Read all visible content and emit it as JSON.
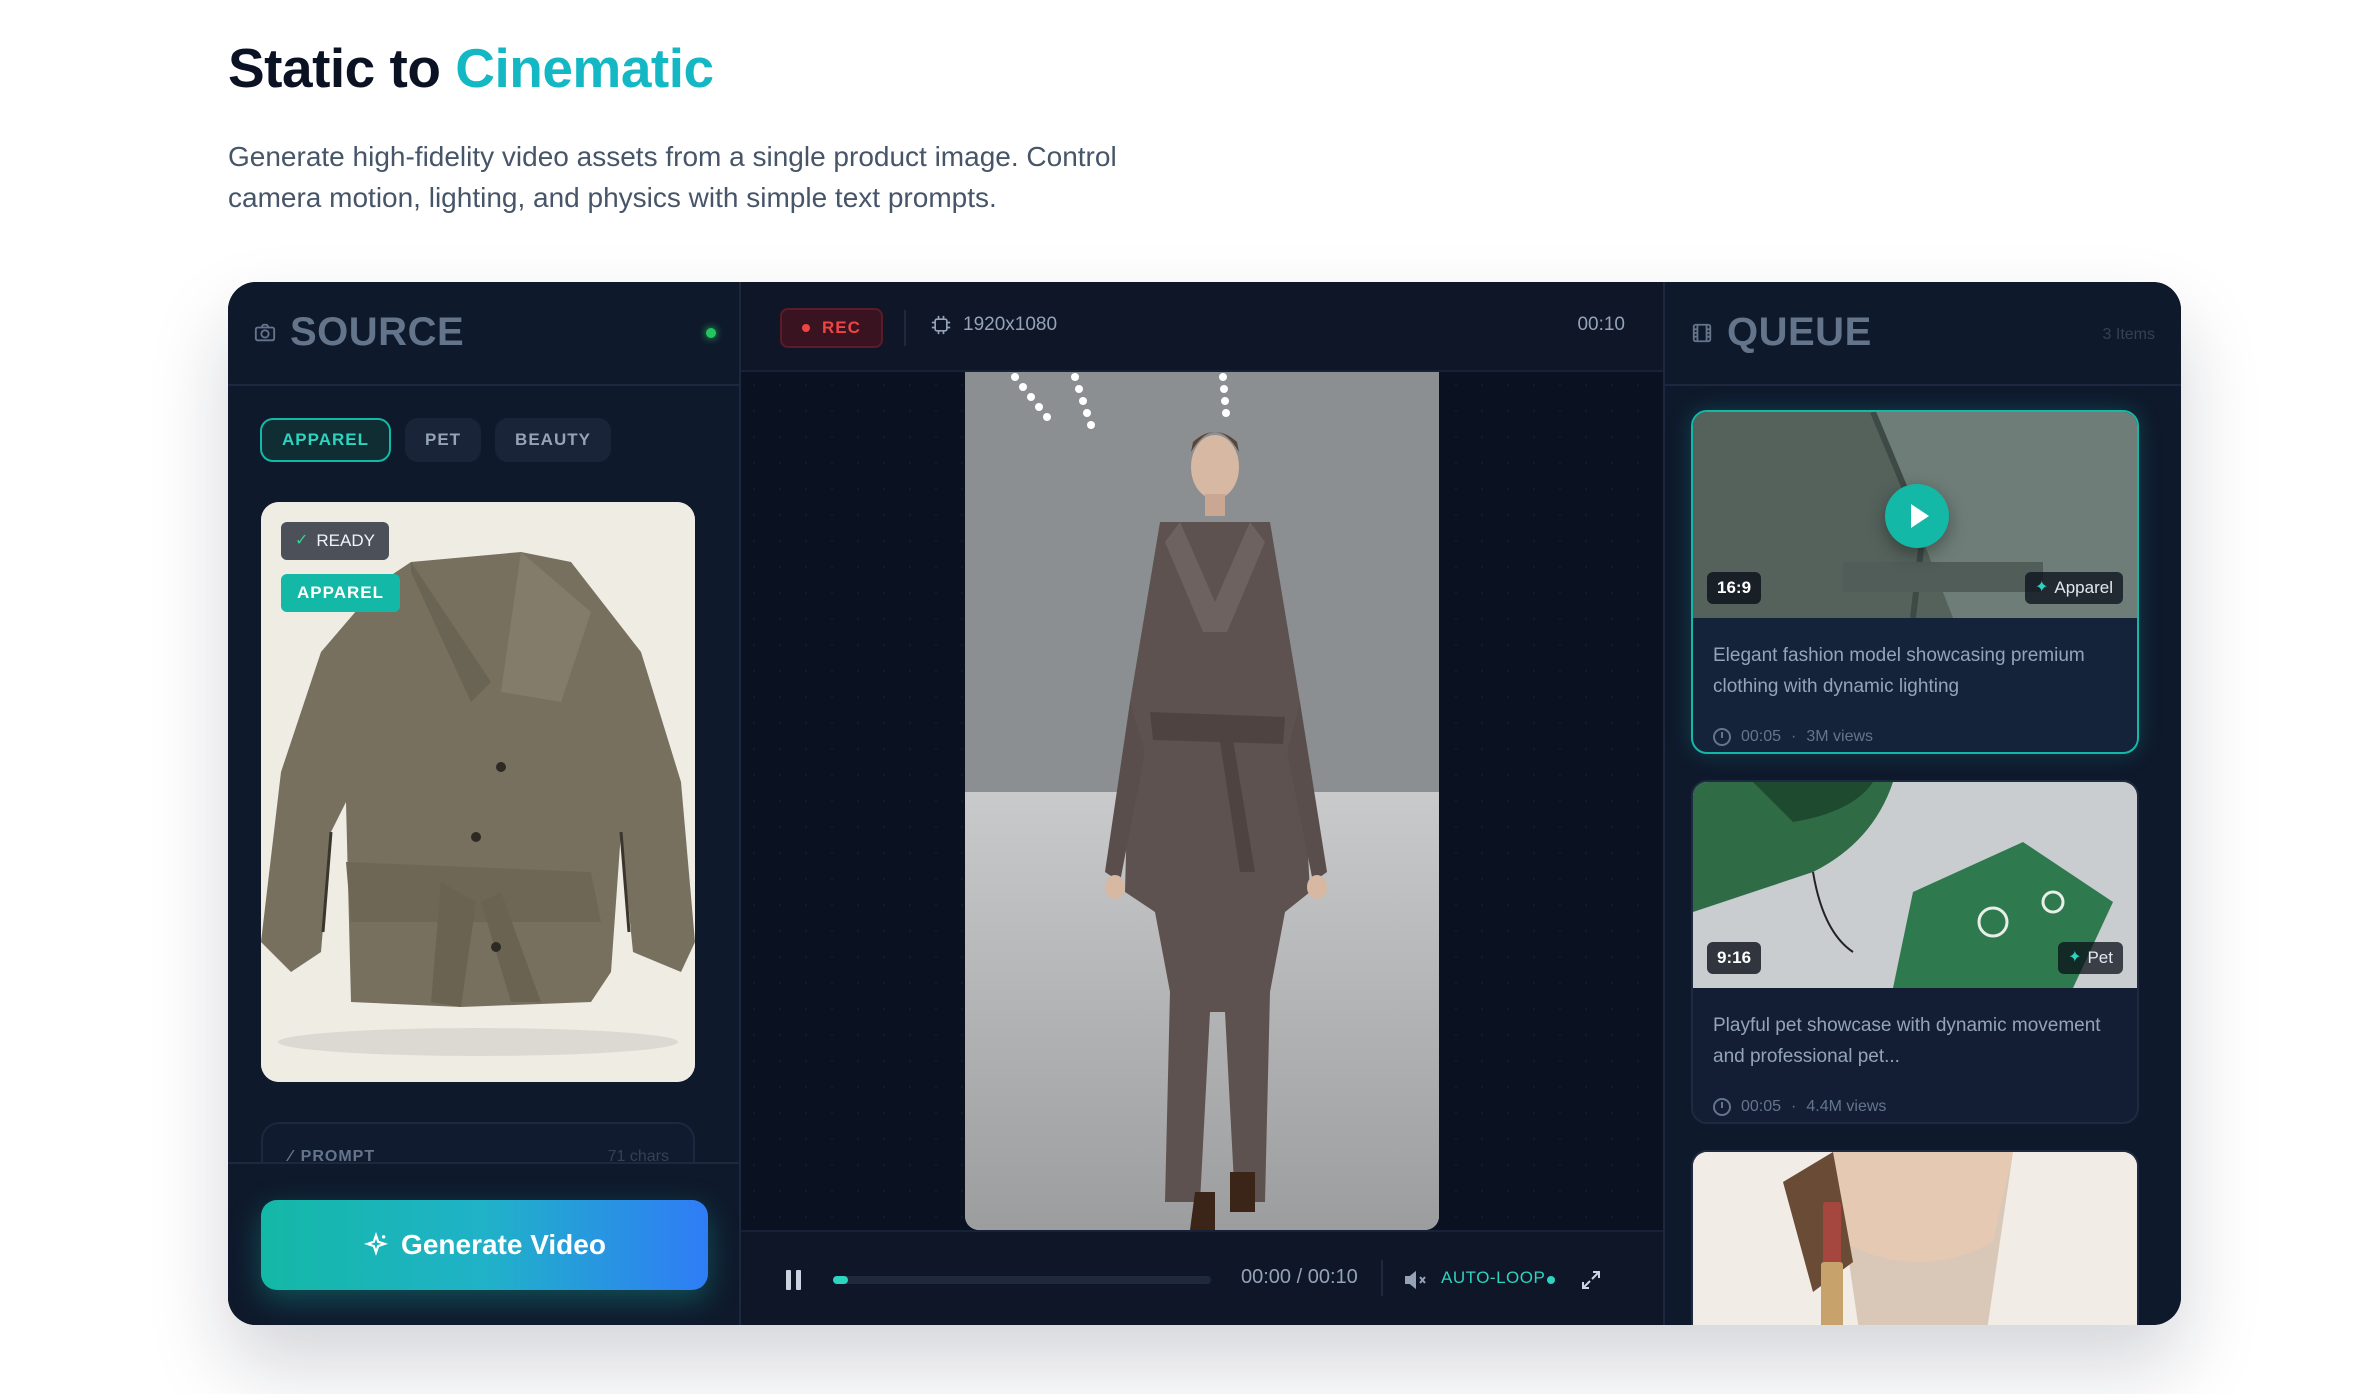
{
  "hero": {
    "title_part1": "Static to ",
    "title_accent": "Cinematic",
    "subtitle": "Generate high-fidelity video assets from a single product image. Control camera motion, lighting, and physics with simple text prompts."
  },
  "source": {
    "title": "SOURCE",
    "icon": "camera-icon",
    "status_color": "#22c55e",
    "chips": [
      {
        "label": "APPAREL",
        "active": true
      },
      {
        "label": "PET",
        "active": false
      },
      {
        "label": "BEAUTY",
        "active": false
      }
    ],
    "card": {
      "ready_label": "READY",
      "category_label": "APPAREL"
    },
    "prompt": {
      "label": "PROMPT",
      "count": "71 chars"
    },
    "generate_label": "Generate Video"
  },
  "player": {
    "rec_label": "REC",
    "resolution": "1920x1080",
    "duration": "00:10",
    "timecode": "00:00 / 00:10",
    "progress": 0.04,
    "autoloop_label": "AUTO-LOOP"
  },
  "queue": {
    "title": "QUEUE",
    "count": "3 Items",
    "items": [
      {
        "ratio": "16:9",
        "tag": "Apparel",
        "description": "Elegant fashion model showcasing premium clothing with dynamic lighting",
        "time": "00:05",
        "views": "3M views"
      },
      {
        "ratio": "9:16",
        "tag": "Pet",
        "description": "Playful pet showcase with dynamic movement and professional pet...",
        "time": "00:05",
        "views": "4.4M views"
      },
      {
        "ratio": "",
        "tag": "",
        "description": "",
        "time": "",
        "views": ""
      }
    ]
  },
  "colors": {
    "accent": "#14b8c4",
    "teal": "#14b8a6",
    "panel": "#0f192c",
    "rec": "#ef4444"
  }
}
